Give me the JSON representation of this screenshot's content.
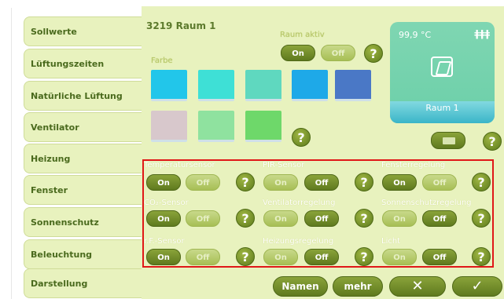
{
  "nav": {
    "items": [
      {
        "label": "Sollwerte"
      },
      {
        "label": "Lüftungszeiten"
      },
      {
        "label": "Natürliche Lüftung"
      },
      {
        "label": "Ventilator"
      },
      {
        "label": "Heizung"
      },
      {
        "label": "Fenster"
      },
      {
        "label": "Sonnenschutz"
      },
      {
        "label": "Beleuchtung"
      },
      {
        "label": "Darstellung"
      }
    ],
    "active": "Darstellung"
  },
  "header": {
    "title": "3219 Raum 1"
  },
  "raum_aktiv": {
    "label": "Raum aktiv",
    "on_label": "On",
    "off_label": "Off",
    "selected": "On"
  },
  "farbe": {
    "label": "Farbe",
    "swatches": [
      "#22c6ea",
      "#3ee0d6",
      "#5fd8bf",
      "#1ea9e8",
      "#4a78c6",
      "#d8c8cc",
      "#8fe29f",
      "#6ed86a"
    ],
    "selected_index": 2
  },
  "preview": {
    "temperature": "99,9 °C",
    "people_icon": "people-icon",
    "window_icon": "window-icon",
    "room_name": "Raum 1"
  },
  "keyboard_icon": "keyboard-icon",
  "help_glyph": "?",
  "sensors": [
    {
      "label": "Temperatursensor",
      "on_label": "On",
      "off_label": "Off",
      "selected": "On"
    },
    {
      "label": "PIR-Sensor",
      "on_label": "On",
      "off_label": "Off",
      "selected": "Off"
    },
    {
      "label": "Fensterregelung",
      "on_label": "On",
      "off_label": "Off",
      "selected": "On"
    },
    {
      "label": "CO₂-Sensor",
      "on_label": "On",
      "off_label": "Off",
      "selected": "On"
    },
    {
      "label": "Ventilatorregelung",
      "on_label": "On",
      "off_label": "Off",
      "selected": "Off"
    },
    {
      "label": "Sonnenschutzregelung",
      "on_label": "On",
      "off_label": "Off",
      "selected": "Off"
    },
    {
      "label": "r.F.-Sensor",
      "on_label": "On",
      "off_label": "Off",
      "selected": "On"
    },
    {
      "label": "Heizungsregelung",
      "on_label": "On",
      "off_label": "Off",
      "selected": "Off"
    },
    {
      "label": "Licht",
      "on_label": "On",
      "off_label": "Off",
      "selected": "Off"
    }
  ],
  "footer": {
    "namen_label": "Namen",
    "mehr_label": "mehr",
    "cancel_glyph": "✕",
    "confirm_glyph": "✓"
  },
  "colors": {
    "accent": "#5f7a1e",
    "panel_bg": "#e8f2be",
    "highlight": "#e01818"
  }
}
